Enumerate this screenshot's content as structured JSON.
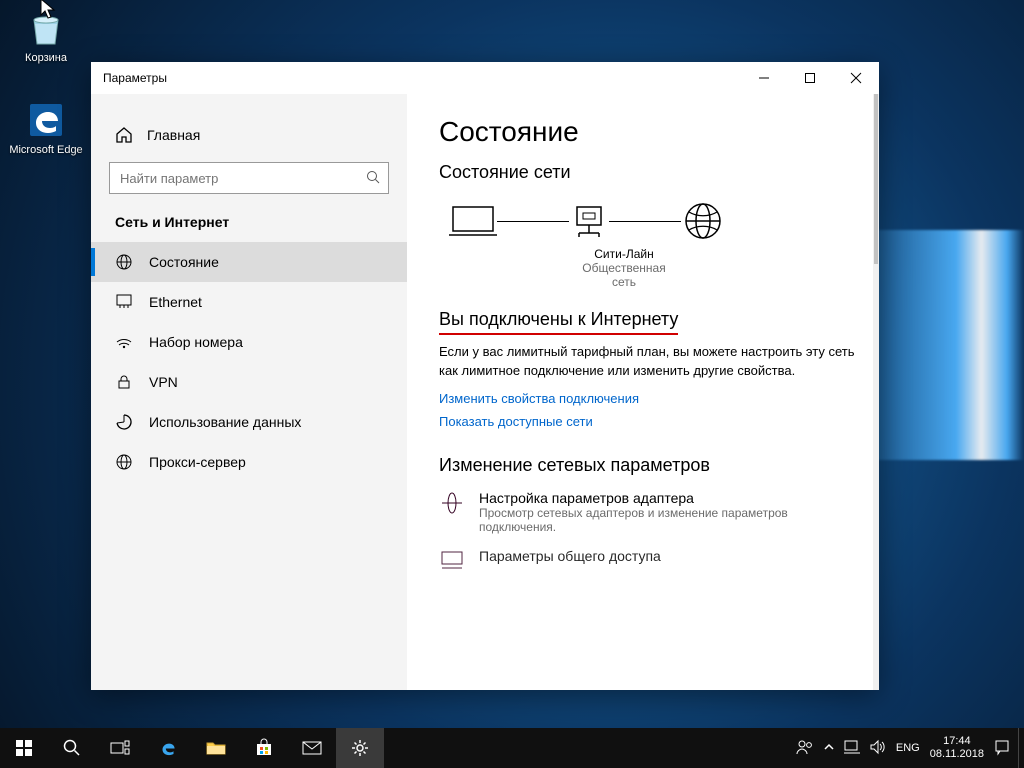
{
  "desktop": {
    "recycle_label": "Корзина",
    "edge_label": "Microsoft Edge"
  },
  "window": {
    "title": "Параметры",
    "sidebar": {
      "home": "Главная",
      "search_placeholder": "Найти параметр",
      "section": "Сеть и Интернет",
      "items": [
        {
          "label": "Состояние"
        },
        {
          "label": "Ethernet"
        },
        {
          "label": "Набор номера"
        },
        {
          "label": "VPN"
        },
        {
          "label": "Использование данных"
        },
        {
          "label": "Прокси-сервер"
        }
      ]
    },
    "content": {
      "h1": "Состояние",
      "h2": "Состояние сети",
      "net_name": "Сити-Лайн",
      "net_type": "Общественная сеть",
      "connected_heading": "Вы подключены к Интернету",
      "connected_body": "Если у вас лимитный тарифный план, вы можете настроить эту сеть как лимитное подключение или изменить другие свойства.",
      "link_change": "Изменить свойства подключения",
      "link_show": "Показать доступные сети",
      "h3": "Изменение сетевых параметров",
      "adapter_title": "Настройка параметров адаптера",
      "adapter_sub": "Просмотр сетевых адаптеров и изменение параметров подключения.",
      "sharing_title": "Параметры общего доступа"
    }
  },
  "taskbar": {
    "lang": "ENG",
    "time": "17:44",
    "date": "08.11.2018"
  }
}
